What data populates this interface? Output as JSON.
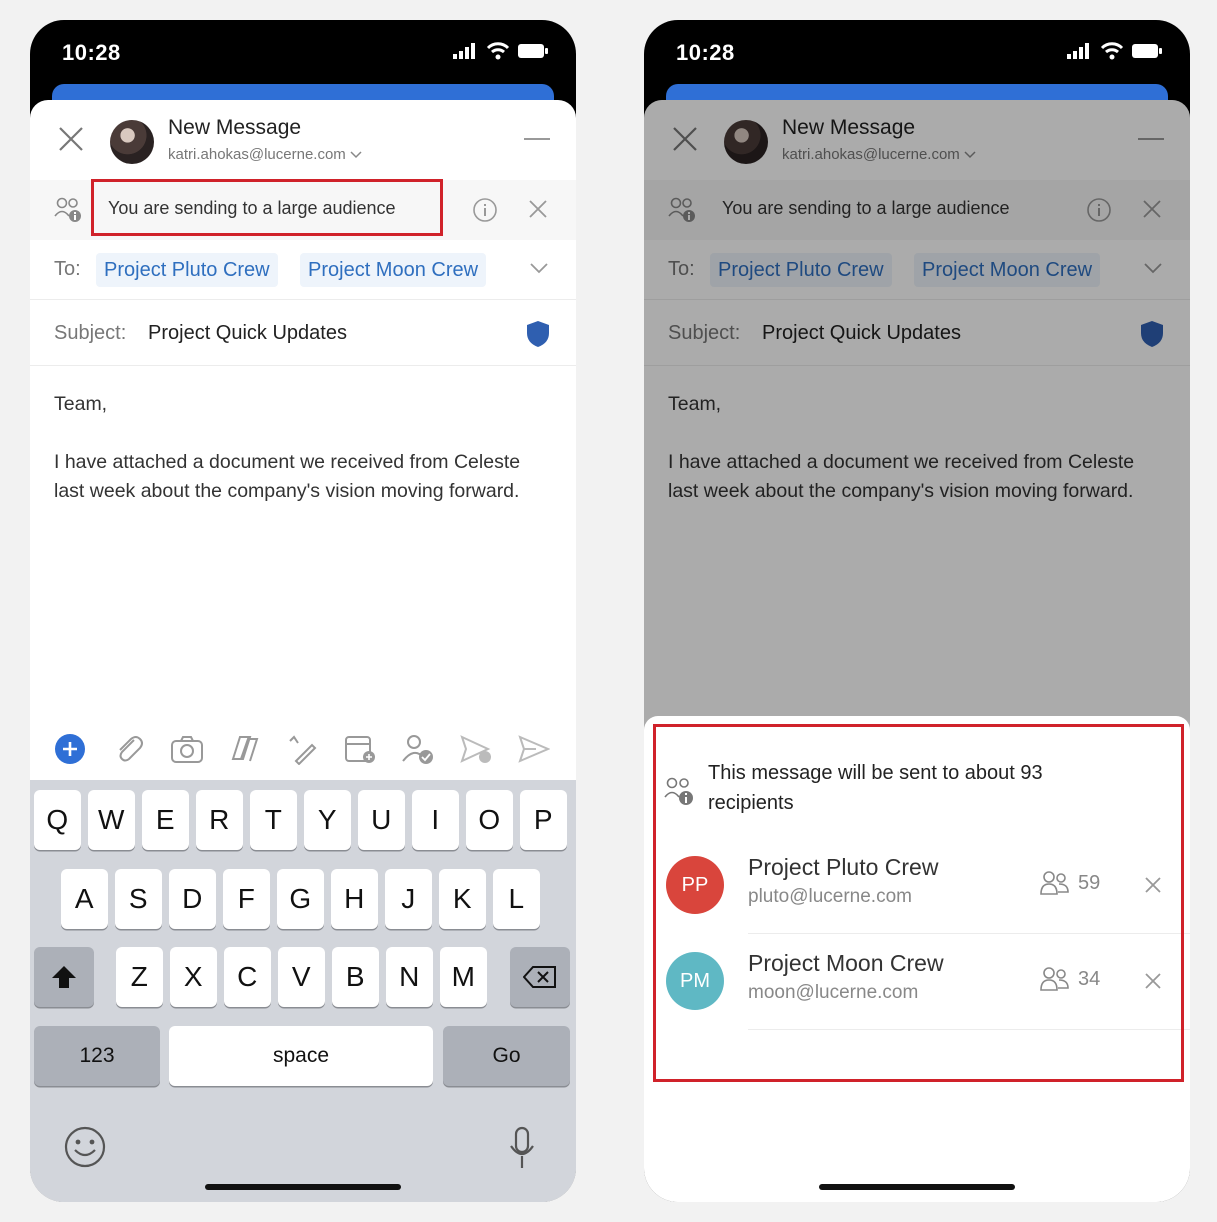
{
  "status": {
    "time": "10:28"
  },
  "compose": {
    "title": "New Message",
    "account": "katri.ahokas@lucerne.com",
    "banner_text": "You are sending to a large audience",
    "to_label": "To:",
    "recipients": [
      "Project Pluto Crew",
      "Project Moon Crew"
    ],
    "subject_label": "Subject:",
    "subject": "Project Quick Updates",
    "body_greeting": "Team,",
    "body_text": "I have attached a document we received from Celeste last week about the company's vision moving forward."
  },
  "toolbar_icons": [
    "add-icon",
    "attach-icon",
    "camera-icon",
    "copilot-icon",
    "draw-icon",
    "calendar-icon",
    "availability-icon",
    "send-later-icon",
    "send-icon"
  ],
  "keyboard": {
    "row1": [
      "Q",
      "W",
      "E",
      "R",
      "T",
      "Y",
      "U",
      "I",
      "O",
      "P"
    ],
    "row2": [
      "A",
      "S",
      "D",
      "F",
      "G",
      "H",
      "J",
      "K",
      "L"
    ],
    "row3": [
      "Z",
      "X",
      "C",
      "V",
      "B",
      "N",
      "M"
    ],
    "numbers_label": "123",
    "space_label": "space",
    "go_label": "Go"
  },
  "audience_sheet": {
    "message": "This message will be sent to about 93 recipients",
    "groups": [
      {
        "initials": "PP",
        "name": "Project Pluto Crew",
        "email": "pluto@lucerne.com",
        "members": "59",
        "color": "#d9453c"
      },
      {
        "initials": "PM",
        "name": "Project Moon Crew",
        "email": "moon@lucerne.com",
        "members": "34",
        "color": "#5fb8c4"
      }
    ]
  },
  "colors": {
    "highlight": "#d0222a",
    "accent": "#2f6fd6",
    "chip_text": "#2f6fbf",
    "shield": "#2f5fb0"
  }
}
